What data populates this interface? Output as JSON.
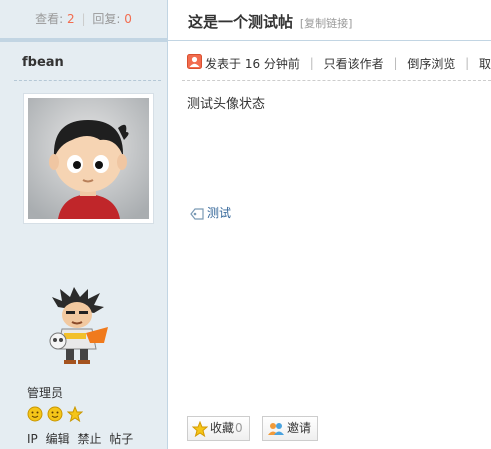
{
  "stats": {
    "views_label": "查看:",
    "views_value": "2",
    "separator": "|",
    "replies_label": "回复:",
    "replies_value": "0"
  },
  "author": {
    "username": "fbean",
    "role": "管理员",
    "medals": [
      "smile-icon",
      "smile-icon",
      "star-icon"
    ],
    "admin_links": [
      "IP",
      "编辑",
      "禁止",
      "帖子"
    ]
  },
  "thread": {
    "title": "这是一个测试帖",
    "copy_link": "[复制链接]"
  },
  "meta": {
    "posted": "发表于 16 分钟前",
    "only_author": "只看该作者",
    "reverse": "倒序浏览",
    "cancel": "取消"
  },
  "post": {
    "body": "测试头像状态",
    "tag": "测试"
  },
  "actions": {
    "favorite_label": "收藏",
    "favorite_count": "0",
    "invite_label": "邀请"
  },
  "colors": {
    "accent_number": "#f26c4f",
    "sidebar_bg": "#e5edf2",
    "border": "#c2d5e3",
    "link": "#336699"
  }
}
